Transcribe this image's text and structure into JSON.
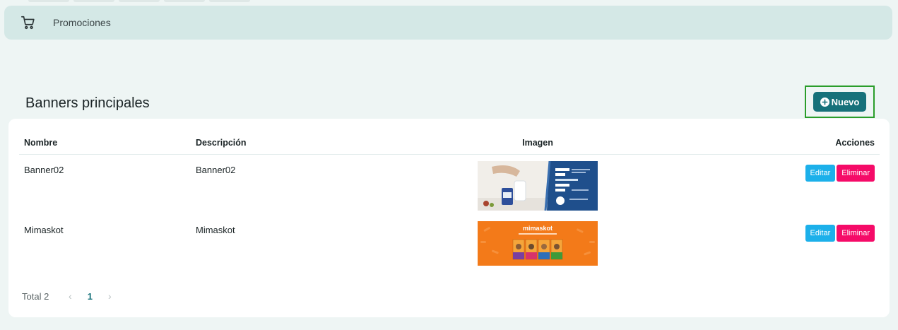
{
  "breadcrumb": {
    "icon": "cart-icon",
    "label": "Promociones"
  },
  "section": {
    "title": "Banners principales",
    "new_button_label": "Nuevo"
  },
  "table": {
    "columns": [
      "Nombre",
      "Descripción",
      "Imagen",
      "Acciones"
    ],
    "rows": [
      {
        "nombre": "Banner02",
        "descripcion": "Banner02",
        "imagen": "banner-image",
        "edit_label": "Editar",
        "delete_label": "Eliminar"
      },
      {
        "nombre": "Mimaskot",
        "descripcion": "Mimaskot",
        "imagen": "mimaskot-banner-image",
        "banner_text": "mimaskot",
        "edit_label": "Editar",
        "delete_label": "Eliminar"
      }
    ]
  },
  "pagination": {
    "total_label": "Total 2",
    "current_page": "1"
  },
  "colors": {
    "primary": "#16717a",
    "edit": "#1cb0ea",
    "delete": "#f50b68",
    "highlight": "#2a9d2a"
  }
}
